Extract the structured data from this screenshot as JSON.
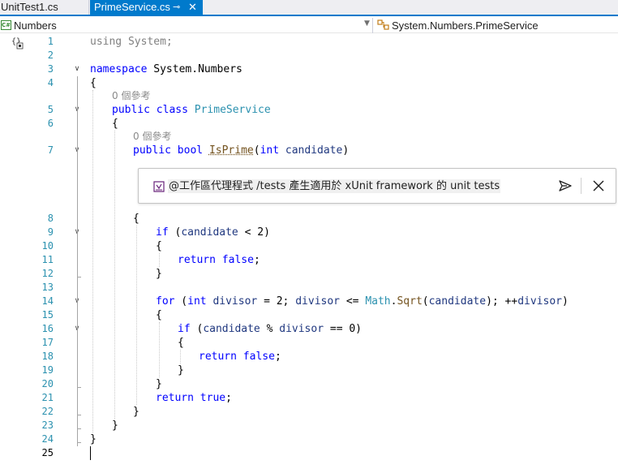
{
  "tabs": [
    {
      "label": "UnitTest1.cs",
      "active": false
    },
    {
      "label": "PrimeService.cs",
      "active": true,
      "pin_glyph": "⊸",
      "close_glyph": "✕"
    }
  ],
  "navbar": {
    "project_icon_text": "C#",
    "project": "Numbers",
    "type": "System.Numbers.PrimeService"
  },
  "line_numbers": [
    "1",
    "2",
    "3",
    "4",
    "5",
    "6",
    "7",
    "8",
    "9",
    "10",
    "11",
    "12",
    "13",
    "14",
    "15",
    "16",
    "17",
    "18",
    "19",
    "20",
    "21",
    "22",
    "23",
    "24",
    "25"
  ],
  "codelens": {
    "class_refs": "0 個參考",
    "method_refs": "0 個參考"
  },
  "code": {
    "l1_using": "using",
    "l1_rest": " System;",
    "l3_kw": "namespace",
    "l3_rest": " System.Numbers",
    "l4": "{",
    "l5_kw1": "public",
    "l5_kw2": "class",
    "l5_type": "PrimeService",
    "l6": "{",
    "l7_kw1": "public",
    "l7_kw2": "bool",
    "l7_method": "IsPrime",
    "l7_p1": "(",
    "l7_kw3": "int",
    "l7_param": "candidate",
    "l7_p2": ")",
    "l8": "{",
    "l9_kw": "if",
    "l9_a": " (",
    "l9_id": "candidate",
    "l9_b": " < 2)",
    "l10": "{",
    "l11_kw1": "return",
    "l11_kw2": "false",
    "l11_end": ";",
    "l12": "}",
    "l14_kw1": "for",
    "l14_a": " (",
    "l14_kw2": "int",
    "l14_id1": "divisor",
    "l14_b": " = 2; ",
    "l14_id2": "divisor",
    "l14_c": " <= ",
    "l14_ty": "Math",
    "l14_d": ".",
    "l14_mt": "Sqrt",
    "l14_e": "(",
    "l14_id3": "candidate",
    "l14_f": "); ++",
    "l14_id4": "divisor",
    "l14_g": ")",
    "l15": "{",
    "l16_kw": "if",
    "l16_a": " (",
    "l16_id1": "candidate",
    "l16_b": " % ",
    "l16_id2": "divisor",
    "l16_c": " == 0)",
    "l17": "{",
    "l18_kw1": "return",
    "l18_kw2": "false",
    "l18_end": ";",
    "l19": "}",
    "l20": "}",
    "l21_kw1": "return",
    "l21_kw2": "true",
    "l21_end": ";",
    "l22": "}",
    "l23": "}",
    "l24": "}"
  },
  "prompt": {
    "text": "@工作區代理程式  /tests  產生適用於  xUnit framework 的 unit tests",
    "send_icon": "send-icon",
    "close_icon": "close-icon"
  },
  "colors": {
    "accent": "#007acc",
    "keyword": "#0000ff",
    "type": "#2b91af",
    "method": "#74531f",
    "identifier": "#1f377f",
    "line_number": "#2b91af"
  }
}
